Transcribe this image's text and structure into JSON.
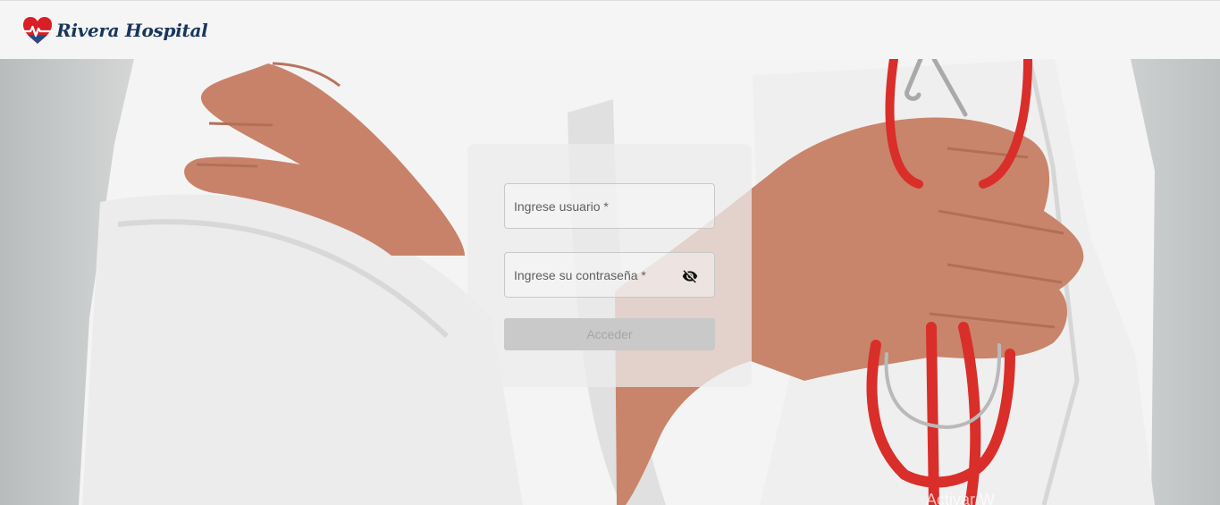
{
  "header": {
    "brand_name": "Rivera Hospital",
    "logo_icon": "heart-pulse-logo-icon",
    "brand_color": "#17365d",
    "logo_heart_color": "#d81f26"
  },
  "login": {
    "username_placeholder": "Ingrese usuario *",
    "password_placeholder": "Ingrese su contraseña *",
    "password_toggle_icon": "eye-off-icon",
    "submit_label": "Acceder",
    "submit_state": "disabled"
  },
  "background": {
    "image_subject": "doctor-with-stethoscope"
  },
  "watermark": {
    "text": "Activar W"
  }
}
